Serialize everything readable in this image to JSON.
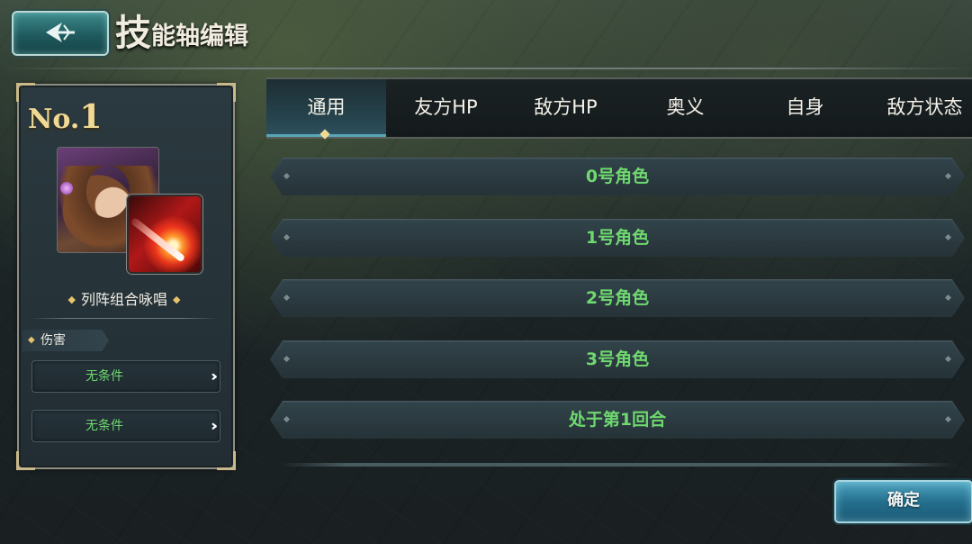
{
  "header": {
    "back_icon": "back-arrow-icon",
    "title_first": "技",
    "title_rest": "能轴编辑"
  },
  "skill_card": {
    "rank_prefix": "No.",
    "rank_number": "1",
    "skill_name": "列阵组合咏唱",
    "type_label": "伤害",
    "conditions": [
      {
        "label": "无条件"
      },
      {
        "label": "无条件"
      }
    ],
    "condition_arrow": "›››"
  },
  "tabs": [
    {
      "label": "通用",
      "active": true
    },
    {
      "label": "友方HP"
    },
    {
      "label": "敌方HP"
    },
    {
      "label": "奥义"
    },
    {
      "label": "自身"
    },
    {
      "label": "敌方状态"
    }
  ],
  "options": [
    {
      "label": "0号角色"
    },
    {
      "label": "1号角色"
    },
    {
      "label": "2号角色"
    },
    {
      "label": "3号角色"
    },
    {
      "label": "处于第1回合"
    }
  ],
  "confirm_label": "确定",
  "colors": {
    "option_text": "#6fd86f",
    "accent_gold": "#f0d995",
    "confirm_button": "#24708e"
  }
}
